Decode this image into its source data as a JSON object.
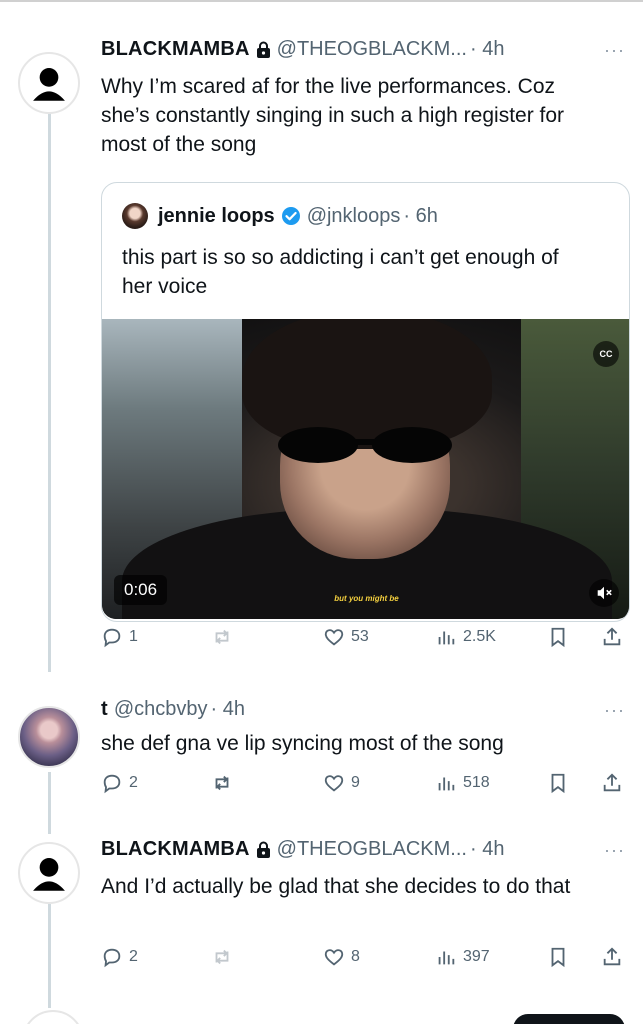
{
  "tweets": [
    {
      "name": "BLACKMAMBA",
      "handle": "@THEOGBLACKM...",
      "time": "· 4h",
      "text": "Why I’m scared af for the live performances. Coz she’s constantly singing in such a high register for most of the song",
      "quote": {
        "name": "jennie loops",
        "handle": "@jnkloops",
        "time": "· 6h",
        "text": "this part is so so addicting i can’t get enough of her voice",
        "video": {
          "duration": "0:06",
          "subtitle": "but you might be",
          "cc_label": "CC"
        }
      },
      "stats": {
        "replies": "1",
        "reposts": "",
        "likes": "53",
        "views": "2.5K"
      }
    },
    {
      "name": "t",
      "handle": "@chcbvby",
      "time": "· 4h",
      "text": "she def gna ve lip syncing most of the song",
      "stats": {
        "replies": "2",
        "reposts": "",
        "likes": "9",
        "views": "518"
      }
    },
    {
      "name": "BLACKMAMBA",
      "handle": "@THEOGBLACKM...",
      "time": "· 4h",
      "text": "And I’d actually be glad that she decides to do that",
      "stats": {
        "replies": "2",
        "reposts": "",
        "likes": "8",
        "views": "397"
      }
    }
  ],
  "icons": {
    "more": "more-icon",
    "reply": "reply-icon",
    "repost": "repost-icon",
    "like": "heart-icon",
    "views": "views-icon",
    "bookmark": "bookmark-icon",
    "share": "share-icon",
    "lock": "lock-icon",
    "verified": "verified-icon"
  },
  "colors": {
    "verified": "#1d9bf0",
    "secondary_text": "#536471",
    "thread_line": "#cfd9de"
  }
}
